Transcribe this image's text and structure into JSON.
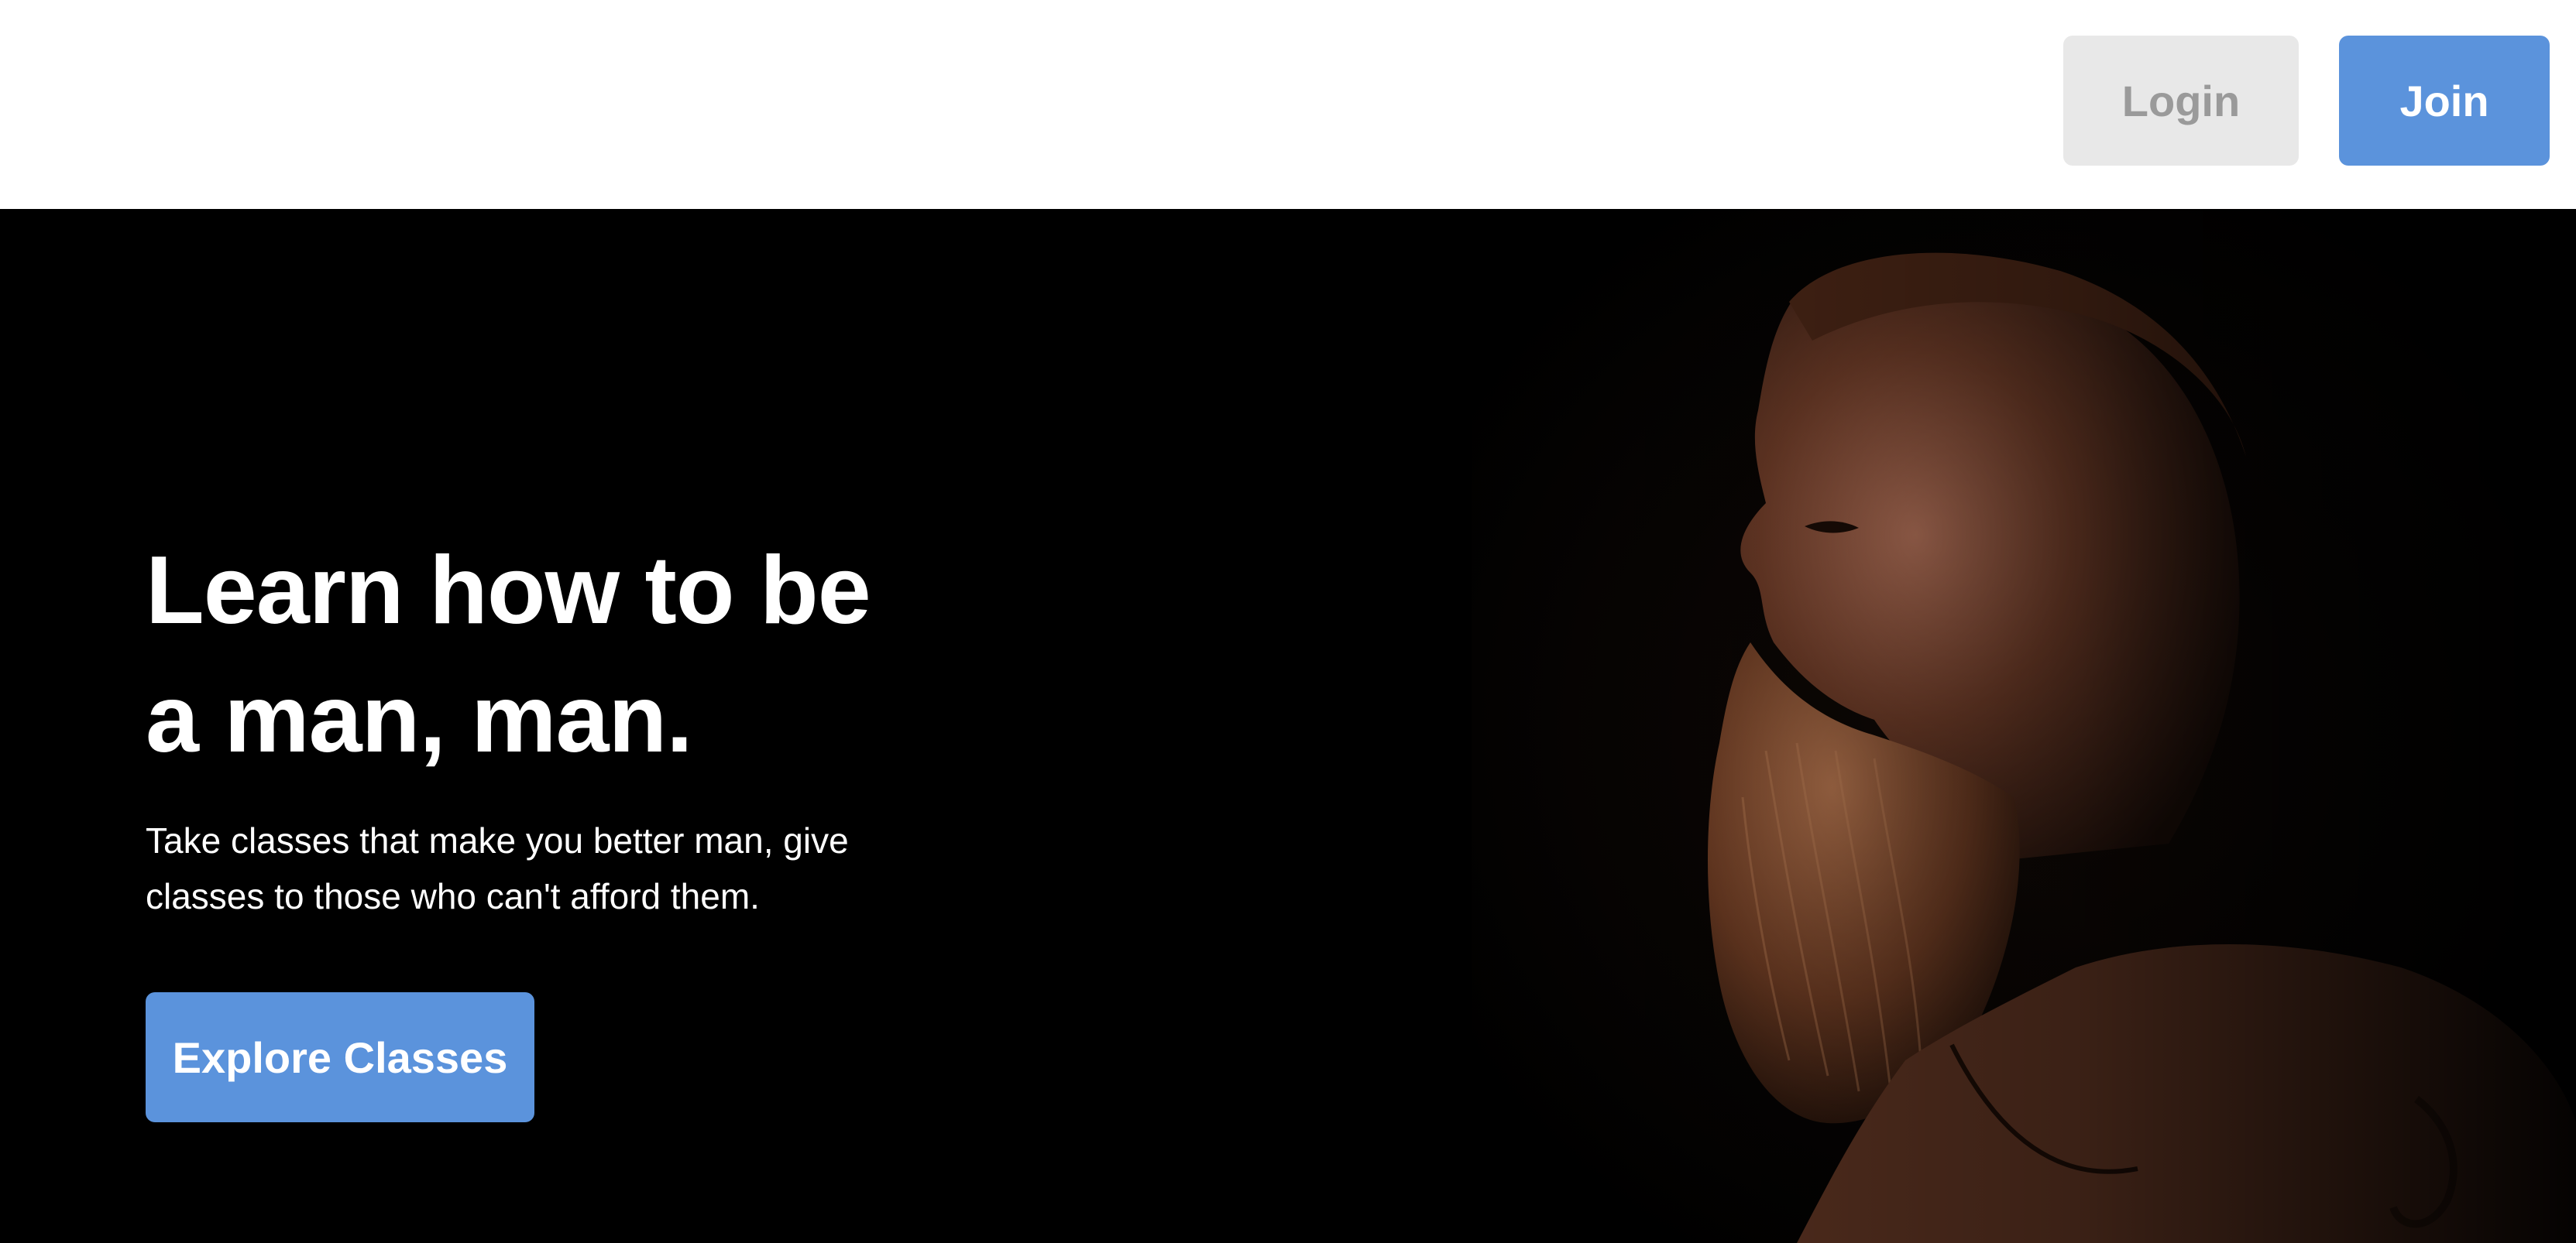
{
  "header": {
    "login_label": "Login",
    "join_label": "Join"
  },
  "hero": {
    "title_line1": "Learn how to be",
    "title_line2": "a man, man.",
    "subtitle_line1": "Take classes that make you better man, give",
    "subtitle_line2": "classes to those who can't afford them.",
    "cta_label": "Explore Classes",
    "image": "bearded-man-profile-photo"
  },
  "colors": {
    "accent": "#5b93dc",
    "login_bg": "#e8e8e8",
    "login_text": "#9a9a9a",
    "hero_bg": "#000000"
  }
}
